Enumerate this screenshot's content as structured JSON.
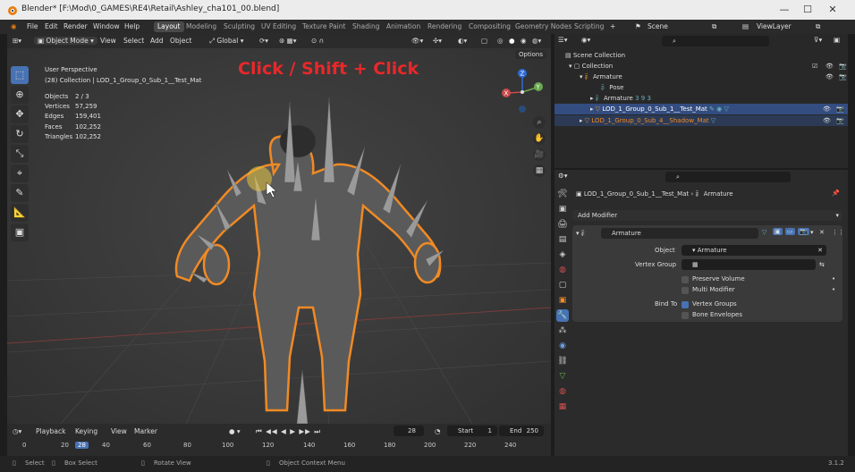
{
  "window": {
    "title": "Blender* [F:\\Mod\\0_GAMES\\RE4\\Retail\\Ashley_cha101_00.blend]",
    "controls": {
      "minimize": "—",
      "maximize": "☐",
      "close": "✕"
    }
  },
  "menu": [
    "File",
    "Edit",
    "Render",
    "Window",
    "Help"
  ],
  "workspaces": [
    "Layout",
    "Modeling",
    "Sculpting",
    "UV Editing",
    "Texture Paint",
    "Shading",
    "Animation",
    "Rendering",
    "Compositing",
    "Geometry Nodes",
    "Scripting"
  ],
  "workspace_add": "+",
  "scene": {
    "name": "Scene",
    "view_layer": "ViewLayer"
  },
  "viewport_header": {
    "mode": "Object Mode",
    "menus": [
      "View",
      "Select",
      "Add",
      "Object"
    ],
    "transform": "Global"
  },
  "viewport": {
    "perspective": "User Perspective",
    "collection_info": "(28) Collection | LOD_1_Group_0_Sub_1__Test_Mat",
    "stats": [
      {
        "label": "Objects",
        "value": "2 / 3"
      },
      {
        "label": "Vertices",
        "value": "57,259"
      },
      {
        "label": "Edges",
        "value": "159,401"
      },
      {
        "label": "Faces",
        "value": "102,252"
      },
      {
        "label": "Triangles",
        "value": "102,252"
      }
    ],
    "overlay_caption": "Click / Shift + Click",
    "options_label": "Options",
    "gizmo": {
      "z": "Z",
      "y": "Y",
      "x": "X"
    }
  },
  "timeline": {
    "menus": [
      "Playback",
      "Keying",
      "View",
      "Marker"
    ],
    "current_frame": "28",
    "start_label": "Start",
    "start": "1",
    "end_label": "End",
    "end": "250",
    "ticks": [
      "0",
      "20",
      "28",
      "40",
      "60",
      "80",
      "100",
      "120",
      "140",
      "160",
      "180",
      "200",
      "220",
      "240"
    ]
  },
  "statusbar": {
    "select": "Select",
    "box_select": "Box Select",
    "rotate": "Rotate View",
    "context": "Object Context Menu",
    "version": "3.1.2"
  },
  "outliner": {
    "items": [
      {
        "label": "Scene Collection",
        "indent": 0
      },
      {
        "label": "Collection",
        "indent": 1
      },
      {
        "label": "Armature",
        "indent": 2
      },
      {
        "label": "Pose",
        "indent": 3
      },
      {
        "label": "Armature",
        "indent": 3
      },
      {
        "label": "LOD_1_Group_0_Sub_1__Test_Mat",
        "indent": 3,
        "selected": true
      },
      {
        "label": "LOD_1_Group_0_Sub_4__Shadow_Mat",
        "indent": 2,
        "selected": true
      }
    ],
    "bone_count": "3 9 3"
  },
  "properties": {
    "breadcrumb_object": "LOD_1_Group_0_Sub_1__Test_Mat",
    "breadcrumb_modifier": "Armature",
    "add_modifier": "Add Modifier",
    "modifier_name": "Armature",
    "object_label": "Object",
    "object_value": "Armature",
    "vertex_group_label": "Vertex Group",
    "preserve_volume": "Preserve Volume",
    "multi_modifier": "Multi Modifier",
    "bind_to_label": "Bind To",
    "vertex_groups": "Vertex Groups",
    "bone_envelopes": "Bone Envelopes"
  },
  "colors": {
    "accent": "#4772b3",
    "caption": "#e8282a",
    "selection": "#f08a24"
  }
}
